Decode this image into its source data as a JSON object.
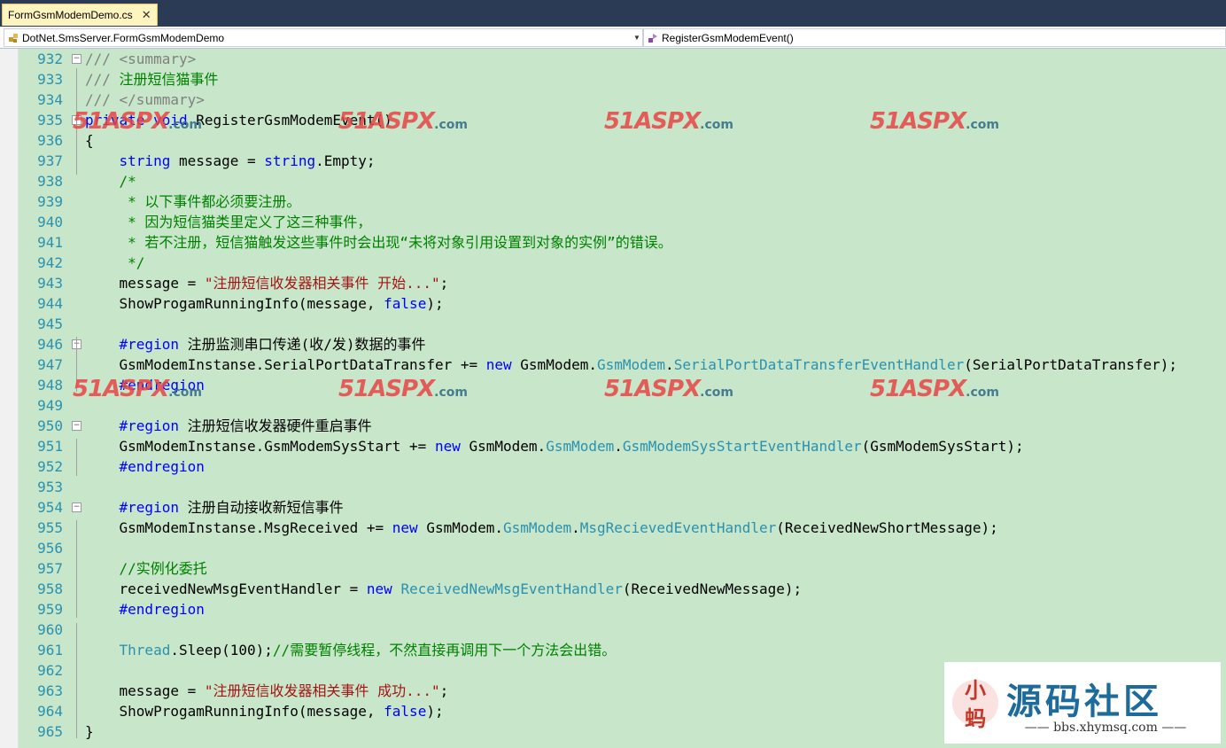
{
  "tab": {
    "title": "FormGsmModemDemo.cs",
    "close": "✕"
  },
  "navbar": {
    "class_selector": "DotNet.SmsServer.FormGsmModemDemo",
    "member_selector": "RegisterGsmModemEvent()"
  },
  "lines": [
    {
      "n": "932",
      "fold": "⊟",
      "segs": [
        {
          "c": "dc",
          "t": "/// <summary>"
        }
      ]
    },
    {
      "n": "933",
      "segs": [
        {
          "c": "dc",
          "t": "/// "
        },
        {
          "c": "cm",
          "t": "注册短信猫事件"
        }
      ]
    },
    {
      "n": "934",
      "segs": [
        {
          "c": "dc",
          "t": "/// </summary>"
        }
      ]
    },
    {
      "n": "935",
      "fold": "⊟",
      "segs": [
        {
          "c": "kw",
          "t": "private"
        },
        {
          "c": "",
          "t": " "
        },
        {
          "c": "kw",
          "t": "void"
        },
        {
          "c": "",
          "t": " RegisterGsmModemEvent()"
        }
      ]
    },
    {
      "n": "936",
      "segs": [
        {
          "c": "",
          "t": "{"
        }
      ]
    },
    {
      "n": "937",
      "segs": [
        {
          "c": "",
          "t": "    "
        },
        {
          "c": "kw",
          "t": "string"
        },
        {
          "c": "",
          "t": " message = "
        },
        {
          "c": "kw",
          "t": "string"
        },
        {
          "c": "",
          "t": ".Empty;"
        }
      ]
    },
    {
      "n": "938",
      "segs": [
        {
          "c": "cm",
          "t": "    /*"
        }
      ]
    },
    {
      "n": "939",
      "segs": [
        {
          "c": "cm",
          "t": "     * 以下事件都必须要注册。"
        }
      ]
    },
    {
      "n": "940",
      "segs": [
        {
          "c": "cm",
          "t": "     * 因为短信猫类里定义了这三种事件，"
        }
      ]
    },
    {
      "n": "941",
      "segs": [
        {
          "c": "cm",
          "t": "     * 若不注册，短信猫触发这些事件时会出现“未将对象引用设置到对象的实例”的错误。"
        }
      ]
    },
    {
      "n": "942",
      "segs": [
        {
          "c": "cm",
          "t": "     */"
        }
      ]
    },
    {
      "n": "943",
      "segs": [
        {
          "c": "",
          "t": "    message = "
        },
        {
          "c": "st",
          "t": "\"注册短信收发器相关事件 开始...\""
        },
        {
          "c": "",
          "t": ";"
        }
      ]
    },
    {
      "n": "944",
      "segs": [
        {
          "c": "",
          "t": "    ShowProgamRunningInfo(message, "
        },
        {
          "c": "kw",
          "t": "false"
        },
        {
          "c": "",
          "t": ");"
        }
      ]
    },
    {
      "n": "945",
      "segs": []
    },
    {
      "n": "946",
      "fold": "⊟",
      "segs": [
        {
          "c": "",
          "t": "    "
        },
        {
          "c": "kw",
          "t": "#region"
        },
        {
          "c": "",
          "t": " 注册监测串口传递(收/发)数据的事件"
        }
      ]
    },
    {
      "n": "947",
      "segs": [
        {
          "c": "",
          "t": "    GsmModemInstanse.SerialPortDataTransfer += "
        },
        {
          "c": "kw",
          "t": "new"
        },
        {
          "c": "",
          "t": " GsmModem."
        },
        {
          "c": "ty",
          "t": "GsmModem"
        },
        {
          "c": "",
          "t": "."
        },
        {
          "c": "ty",
          "t": "SerialPortDataTransferEventHandler"
        },
        {
          "c": "",
          "t": "(SerialPortDataTransfer);"
        }
      ]
    },
    {
      "n": "948",
      "segs": [
        {
          "c": "",
          "t": "    "
        },
        {
          "c": "kw",
          "t": "#endregion"
        }
      ]
    },
    {
      "n": "949",
      "segs": []
    },
    {
      "n": "950",
      "fold": "⊟",
      "segs": [
        {
          "c": "",
          "t": "    "
        },
        {
          "c": "kw",
          "t": "#region"
        },
        {
          "c": "",
          "t": " 注册短信收发器硬件重启事件"
        }
      ]
    },
    {
      "n": "951",
      "segs": [
        {
          "c": "",
          "t": "    GsmModemInstanse.GsmModemSysStart += "
        },
        {
          "c": "kw",
          "t": "new"
        },
        {
          "c": "",
          "t": " GsmModem."
        },
        {
          "c": "ty",
          "t": "GsmModem"
        },
        {
          "c": "",
          "t": "."
        },
        {
          "c": "ty",
          "t": "GsmModemSysStartEventHandler"
        },
        {
          "c": "",
          "t": "(GsmModemSysStart);"
        }
      ]
    },
    {
      "n": "952",
      "segs": [
        {
          "c": "",
          "t": "    "
        },
        {
          "c": "kw",
          "t": "#endregion"
        }
      ]
    },
    {
      "n": "953",
      "segs": []
    },
    {
      "n": "954",
      "fold": "⊟",
      "segs": [
        {
          "c": "",
          "t": "    "
        },
        {
          "c": "kw",
          "t": "#region"
        },
        {
          "c": "",
          "t": " 注册自动接收新短信事件"
        }
      ]
    },
    {
      "n": "955",
      "segs": [
        {
          "c": "",
          "t": "    GsmModemInstanse.MsgReceived += "
        },
        {
          "c": "kw",
          "t": "new"
        },
        {
          "c": "",
          "t": " GsmModem."
        },
        {
          "c": "ty",
          "t": "GsmModem"
        },
        {
          "c": "",
          "t": "."
        },
        {
          "c": "ty",
          "t": "MsgRecievedEventHandler"
        },
        {
          "c": "",
          "t": "(ReceivedNewShortMessage);"
        }
      ]
    },
    {
      "n": "956",
      "segs": []
    },
    {
      "n": "957",
      "segs": [
        {
          "c": "cm",
          "t": "    //实例化委托"
        }
      ]
    },
    {
      "n": "958",
      "segs": [
        {
          "c": "",
          "t": "    receivedNewMsgEventHandler = "
        },
        {
          "c": "kw",
          "t": "new"
        },
        {
          "c": "",
          "t": " "
        },
        {
          "c": "ty",
          "t": "ReceivedNewMsgEventHandler"
        },
        {
          "c": "",
          "t": "(ReceivedNewMessage);"
        }
      ]
    },
    {
      "n": "959",
      "segs": [
        {
          "c": "",
          "t": "    "
        },
        {
          "c": "kw",
          "t": "#endregion"
        }
      ]
    },
    {
      "n": "960",
      "segs": []
    },
    {
      "n": "961",
      "segs": [
        {
          "c": "",
          "t": "    "
        },
        {
          "c": "ty",
          "t": "Thread"
        },
        {
          "c": "",
          "t": ".Sleep(100);"
        },
        {
          "c": "cm",
          "t": "//需要暂停线程，不然直接再调用下一个方法会出错。"
        }
      ]
    },
    {
      "n": "962",
      "segs": []
    },
    {
      "n": "963",
      "segs": [
        {
          "c": "",
          "t": "    message = "
        },
        {
          "c": "st",
          "t": "\"注册短信收发器相关事件 成功...\""
        },
        {
          "c": "",
          "t": ";"
        }
      ]
    },
    {
      "n": "964",
      "segs": [
        {
          "c": "",
          "t": "    ShowProgamRunningInfo(message, "
        },
        {
          "c": "kw",
          "t": "false"
        },
        {
          "c": "",
          "t": ");"
        }
      ]
    },
    {
      "n": "965",
      "segs": [
        {
          "c": "",
          "t": "}"
        }
      ]
    }
  ],
  "watermark": {
    "num": "51",
    "word": "ASPX",
    "suffix": ".com"
  },
  "badge": {
    "title": "源码社区",
    "url": "—— bbs.xhymsq.com ——",
    "logo_text": "小蚂"
  },
  "colors": {
    "background": "#c8e6c9",
    "keyword": "#0000ff",
    "comment": "#008000",
    "doc": "#808080",
    "string": "#a31515",
    "type": "#2b91af",
    "line_number": "#2b91af"
  }
}
